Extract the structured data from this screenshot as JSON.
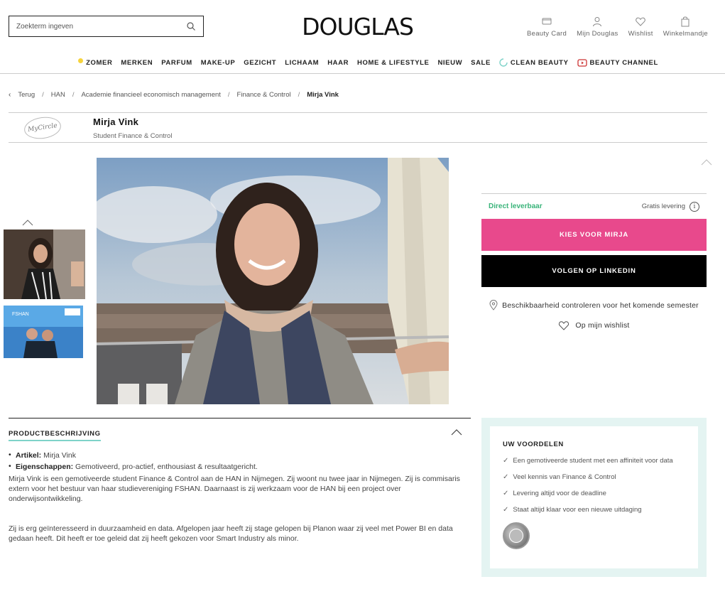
{
  "header": {
    "search_placeholder": "Zoekterm ingeven",
    "logo": "DOUGLAS",
    "actions": [
      {
        "label": "Beauty Card",
        "icon": "card-icon"
      },
      {
        "label": "Mijn Douglas",
        "icon": "user-icon"
      },
      {
        "label": "Wishlist",
        "icon": "heart-icon"
      },
      {
        "label": "Winkelmandje",
        "icon": "bag-icon"
      }
    ]
  },
  "nav": {
    "items": [
      "ZOMER",
      "MERKEN",
      "PARFUM",
      "MAKE-UP",
      "GEZICHT",
      "LICHAAM",
      "HAAR",
      "HOME & LIFESTYLE",
      "NIEUW",
      "SALE",
      "CLEAN BEAUTY",
      "BEAUTY CHANNEL"
    ]
  },
  "breadcrumb": {
    "back": "Terug",
    "items": [
      "HAN",
      "Academie financieel economisch management",
      "Finance & Control"
    ],
    "current": "Mirja Vink"
  },
  "brand": {
    "logo_text": "MyCircle",
    "name": "Mirja Vink",
    "subtitle": "Student Finance & Control"
  },
  "buybox": {
    "availability": "Direct leverbaar",
    "shipping": "Gratis levering",
    "primary_button": "KIES VOOR MIRJA",
    "secondary_button": "VOLGEN OP LINKEDIN",
    "check_availability": "Beschikbaarheid controleren voor het komende semester",
    "wishlist": "Op mijn wishlist"
  },
  "description": {
    "title": "PRODUCTBESCHRIJVING",
    "article_label": "Artikel:",
    "article_value": "Mirja Vink",
    "props_label": "Eigenschappen:",
    "props_value": "Gemotiveerd, pro-actief, enthousiast & resultaatgericht.",
    "paragraph1": "Mirja Vink is een gemotiveerde student Finance & Control aan de HAN in Nijmegen. Zij woont nu twee jaar in Nijmegen. Zij is commisaris extern voor het bestuur van haar studievereniging FSHAN. Daarnaast is zij werkzaam voor de HAN bij een project over onderwijsontwikkeling.",
    "paragraph2": "Zij is erg geïnteresseerd in duurzaamheid en data. Afgelopen jaar heeft zij stage gelopen bij Planon waar zij veel met Power BI en data gedaan heeft. Dit heeft er toe geleid dat zij heeft gekozen voor Smart Industry als minor."
  },
  "benefits": {
    "title": "UW VOORDELEN",
    "items": [
      "Een gemotiveerde student met een affiniteit voor data",
      "Veel kennis van Finance & Control",
      "Levering altijd voor de deadline",
      "Staat altijd klaar voor een nieuwe uitdaging"
    ]
  },
  "colors": {
    "pink": "#e8498c",
    "green": "#3ab47a",
    "mint": "#e4f4f2"
  }
}
